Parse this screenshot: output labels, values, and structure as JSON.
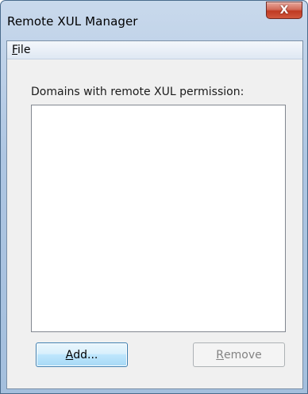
{
  "window": {
    "title": "Remote XUL Manager",
    "close_symbol": "X"
  },
  "menubar": {
    "file_mnemonic": "F",
    "file_rest": "ile"
  },
  "main": {
    "list_label": "Domains with remote XUL permission:",
    "domains": []
  },
  "buttons": {
    "add_mnemonic": "A",
    "add_rest": "dd...",
    "remove_mnemonic": "R",
    "remove_rest": "emove",
    "remove_enabled": false
  },
  "colors": {
    "close_button": "#c03a22",
    "title_gradient": "#aec6e2",
    "default_button_border": "#3c7fb1"
  }
}
